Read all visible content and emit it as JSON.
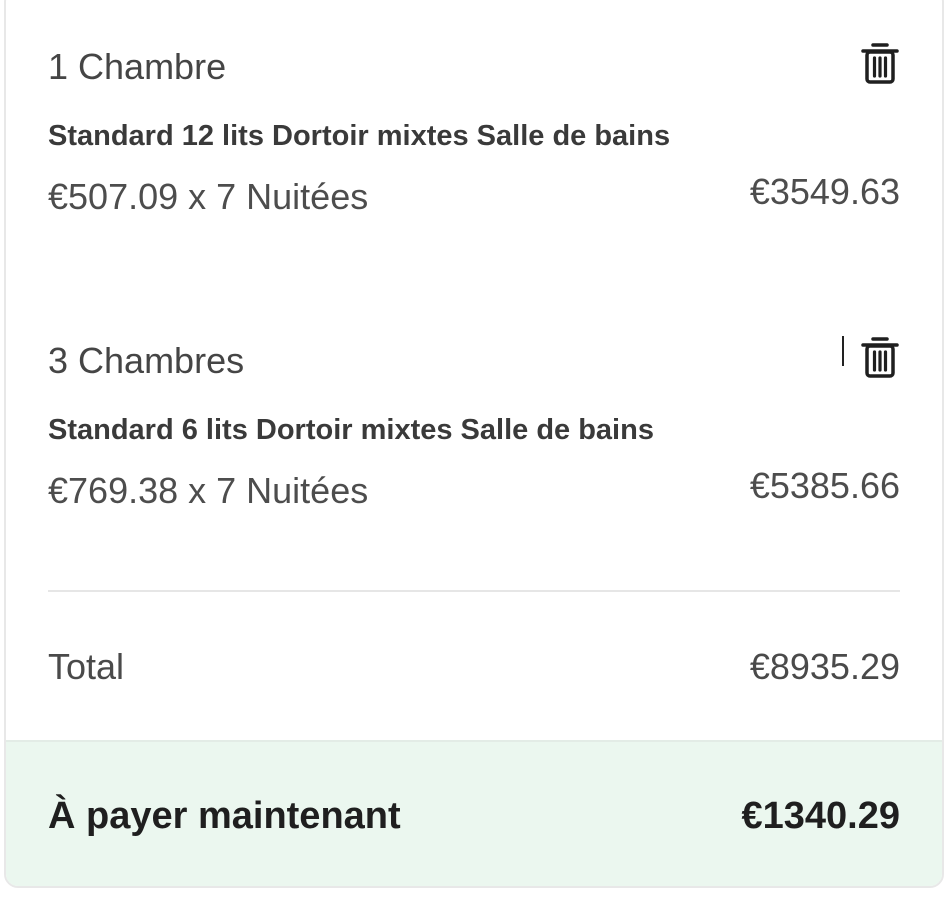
{
  "rooms": [
    {
      "count_label": "1 Chambre",
      "room_type": "Standard 12 lits Dortoir mixtes Salle de bains",
      "price_calc": "€507.09 x 7 Nuitées",
      "amount": "€3549.63",
      "delete_icon": "trash-icon"
    },
    {
      "count_label": "3 Chambres",
      "room_type": "Standard 6 lits Dortoir mixtes Salle de bains",
      "price_calc": "€769.38 x 7 Nuitées",
      "amount": "€5385.66",
      "delete_icon": "trash-icon"
    }
  ],
  "total": {
    "label": "Total",
    "amount": "€8935.29"
  },
  "pay_now": {
    "label": "À payer maintenant",
    "amount": "€1340.29",
    "background_color": "#ebf7ef"
  }
}
